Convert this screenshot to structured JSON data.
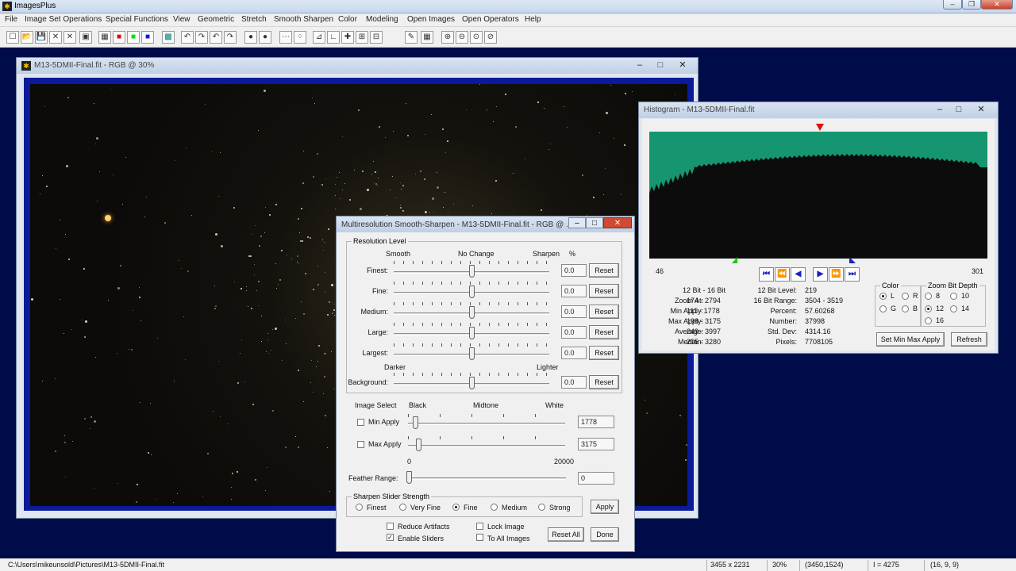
{
  "app": {
    "title": "ImagesPlus",
    "caption_min": "–",
    "caption_max": "❐",
    "caption_close": "✕"
  },
  "menu": {
    "items": [
      "File",
      "Image Set Operations",
      "Special Functions",
      "View",
      "Geometric",
      "Stretch",
      "Smooth Sharpen",
      "Color",
      "Modeling",
      "Open Images",
      "Open Operators",
      "Help"
    ]
  },
  "toolbar": {
    "icons": [
      "new-icon",
      "open-icon",
      "save-icon",
      "close-red-icon",
      "close-green-icon",
      "copy-icon",
      "rgb-icon",
      "red-channel-icon",
      "green-channel-icon",
      "blue-channel-icon",
      "grid-icon",
      "undo-icon",
      "redo-icon",
      "undo-red-icon",
      "redo-red-icon",
      "record-icon",
      "record-red-icon",
      "dots-icon",
      "points-icon",
      "histogram-icon",
      "curve-icon",
      "crosshair-icon",
      "crop-icon",
      "stack-icon",
      "brush-icon",
      "table-icon",
      "zoom-in-icon",
      "zoom-out-icon",
      "zoom-fit-icon",
      "zoom-reset-icon"
    ],
    "glyphs": [
      "☐",
      "📂",
      "💾",
      "✕",
      "✕",
      "▣",
      "▦",
      "■",
      "■",
      "■",
      "▩",
      "↶",
      "↷",
      "↶",
      "↷",
      "●",
      "●",
      "⋯",
      "⁘",
      "⊿",
      "∟",
      "✚",
      "⊞",
      "⊟",
      "✎",
      "▦",
      "⊕",
      "⊖",
      "⊙",
      "⊘"
    ],
    "colors": {
      "red": "#e80000",
      "green": "#00dd00",
      "blue": "#0020e0",
      "teal": "#008080"
    }
  },
  "image_window": {
    "title": "M13-5DMII-Final.fit - RGB @ 30%",
    "btn_min": "–",
    "btn_max": "□",
    "btn_close": "✕"
  },
  "histogram": {
    "title": "Histogram - M13-5DMII-Final.fit",
    "fill_color": "#169670",
    "left_value": "46",
    "right_value": "301",
    "left_labels": [
      "12 Bit - 16 Bit",
      "Zoom At:",
      "Min Apply:",
      "Max Apply:",
      "Average:",
      "Median:"
    ],
    "left_values": [
      "",
      "174 - 2794",
      "111 - 1778",
      "198 - 3175",
      "249 - 3997",
      "205 - 3280"
    ],
    "right_labels": [
      "12 Bit Level:",
      "16 Bit Range:",
      "Percent:",
      "Number:",
      "Std. Dev:",
      "Pixels:"
    ],
    "right_values": [
      "219",
      "3504 - 3519",
      "57.60268",
      "37998",
      "4314.16",
      "7708105"
    ],
    "nav": [
      "⏮",
      "⏪",
      "◀",
      "▶",
      "⏩",
      "⏭"
    ],
    "color_group": "Color",
    "color_options": [
      "L",
      "R",
      "G",
      "B"
    ],
    "color_selected": "L",
    "zoom_group": "Zoom Bit Depth",
    "zoom_options": [
      "8",
      "10",
      "12",
      "14",
      "16"
    ],
    "zoom_selected": "12",
    "set_button": "Set Min Max Apply",
    "refresh_button": "Refresh"
  },
  "dialog": {
    "title": "Multiresolution Smooth-Sharpen - M13-5DMII-Final.fit - RGB @ ...",
    "group_resolution": "Resolution Level",
    "head_smooth": "Smooth",
    "head_nochange": "No Change",
    "head_sharpen": "Sharpen",
    "head_percent": "%",
    "levels": [
      {
        "label": "Finest:",
        "value": "0.0",
        "reset": "Reset"
      },
      {
        "label": "Fine:",
        "value": "0.0",
        "reset": "Reset"
      },
      {
        "label": "Medium:",
        "value": "0.0",
        "reset": "Reset"
      },
      {
        "label": "Large:",
        "value": "0.0",
        "reset": "Reset"
      },
      {
        "label": "Largest:",
        "value": "0.0",
        "reset": "Reset"
      }
    ],
    "darker": "Darker",
    "lighter": "Lighter",
    "background": {
      "label": "Background:",
      "value": "0.0",
      "reset": "Reset"
    },
    "image_select": "Image Select",
    "head_black": "Black",
    "head_midtone": "Midtone",
    "head_white": "White",
    "min_apply": {
      "label": "Min Apply",
      "value": "1778",
      "checked": false
    },
    "max_apply": {
      "label": "Max Apply",
      "value": "3175",
      "checked": false
    },
    "scale_min": "0",
    "scale_max": "20000",
    "feather": {
      "label": "Feather Range:",
      "value": "0"
    },
    "group_strength": "Sharpen Slider Strength",
    "strength_options": [
      "Finest",
      "Very Fine",
      "Fine",
      "Medium",
      "Strong"
    ],
    "strength_selected": "Fine",
    "apply": "Apply",
    "reduce_artifacts": {
      "label": "Reduce Artifacts",
      "checked": false
    },
    "enable_sliders": {
      "label": "Enable Sliders",
      "checked": true
    },
    "lock_image": {
      "label": "Lock Image",
      "checked": false
    },
    "to_all_images": {
      "label": "To All Images",
      "checked": false
    },
    "reset_all": "Reset All",
    "done": "Done"
  },
  "status": {
    "path": "C:\\Users\\mikeunsold\\Pictures\\M13-5DMII-Final.fit",
    "dimensions": "3455 x 2231",
    "zoom": "30%",
    "coords": "(3450,1524)",
    "intensity": "I = 4275",
    "rgb": "(16, 9, 9)"
  }
}
